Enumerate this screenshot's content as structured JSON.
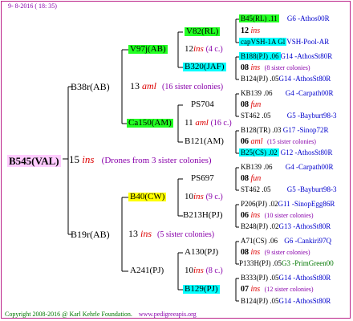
{
  "header": {
    "version": "9- 8-2016 ( 18: 35)"
  },
  "root": {
    "name": "B545(VAL)",
    "num": "15",
    "mark": "ins",
    "note": "(Drones from 3 sister colonies)"
  },
  "gen1": [
    {
      "name": "B38r(AB)",
      "num": "13",
      "mark": "aml",
      "note": "(16 sister colonies)"
    },
    {
      "name": "B19r(AB)",
      "num": "13",
      "mark": "ins",
      "note": "(5 sister colonies)"
    }
  ],
  "gen2": [
    {
      "name": "V97j(AB)",
      "num": "12",
      "mark": "ins",
      "note": "(4 c.)"
    },
    {
      "name": "Ca150(AM)",
      "num": "11",
      "mark": "aml",
      "note": "(16 c.)"
    },
    {
      "name": "B40(CW)",
      "num": "10",
      "mark": "ins",
      "note": "(9 c.)"
    },
    {
      "name": "A241(PJ)",
      "num": "10",
      "mark": "ins",
      "note": "(8 c.)"
    }
  ],
  "gen3": [
    {
      "name": "V82(RL)"
    },
    {
      "name": "B320(JAF)"
    },
    {
      "name": "PS704"
    },
    {
      "name": "B121(AM)"
    },
    {
      "name": "PS697"
    },
    {
      "name": "B213H(PJ)"
    },
    {
      "name": "A130(PJ)"
    },
    {
      "name": "B129(PJ)"
    }
  ],
  "gen4": [
    {
      "a": "B45(RL) .11",
      "b": "G6 -Athos00R"
    },
    {
      "a": "12",
      "b": "ins"
    },
    {
      "a": "capVSH-1A Gl",
      "b": "VSH-Pool-AR"
    },
    {
      "a": "B188(PJ) .06",
      "b": "G14 -AthosSt80R"
    },
    {
      "a": "08",
      "b": "ins",
      "c": "(8 sister colonies)"
    },
    {
      "a": "B124(PJ) .05",
      "b": "G14 -AthosSt80R"
    },
    {
      "a": "KB139 .06",
      "b": "G4 -Carpath00R"
    },
    {
      "a": "08",
      "b": "fun"
    },
    {
      "a": "ST462 .05",
      "b": "G5 -Bayburt98-3"
    },
    {
      "a": "B128(TR) .03",
      "b": "G17 -Sinop72R"
    },
    {
      "a": "06",
      "b": "aml",
      "c": "(15 sister colonies)"
    },
    {
      "a": "B25(CS) .02",
      "b": "G12 -AthosSt80R"
    },
    {
      "a": "KB139 .06",
      "b": "G4 -Carpath00R"
    },
    {
      "a": "08",
      "b": "fun"
    },
    {
      "a": "ST462 .05",
      "b": "G5 -Bayburt98-3"
    },
    {
      "a": "P206(PJ) .02",
      "b": "G11 -SinopEgg86R"
    },
    {
      "a": "06",
      "b": "ins",
      "c": "(10 sister colonies)"
    },
    {
      "a": "B248(PJ) .02",
      "b": "G13 -AthosSt80R"
    },
    {
      "a": "A71(CS) .06",
      "b": "G6 -Cankiri97Q"
    },
    {
      "a": "08",
      "b": "ins",
      "c": "(9 sister colonies)"
    },
    {
      "a": "P133H(PJ) .05",
      "b": "G3 -PrimGreen00"
    },
    {
      "a": "B333(PJ) .05",
      "b": "G14 -AthosSt80R"
    },
    {
      "a": "07",
      "b": "ins",
      "c": "(12 sister colonies)"
    },
    {
      "a": "B124(PJ) .05",
      "b": "G14 -AthosSt80R"
    }
  ],
  "footer": {
    "copyright": "Copyright 2008-2016 @ Karl Kehrle Foundation.",
    "url": "www.pedigreeapis.org"
  }
}
